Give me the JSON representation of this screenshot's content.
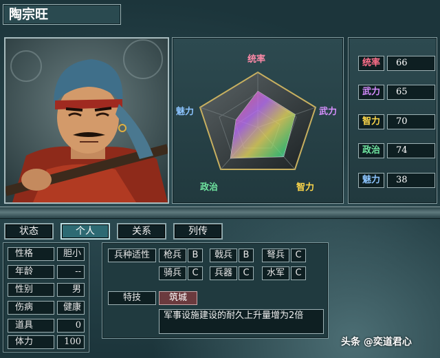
{
  "character": {
    "name": "陶宗旺"
  },
  "radar": {
    "labels": {
      "leadership": "统率",
      "war": "武力",
      "intelligence": "智力",
      "politics": "政治",
      "charm": "魅力"
    },
    "values": {
      "leadership": 66,
      "war": 65,
      "intelligence": 70,
      "politics": 74,
      "charm": 38
    }
  },
  "stats": [
    {
      "label": "统率",
      "value": "66",
      "color": "#ff6f8a"
    },
    {
      "label": "武力",
      "value": "65",
      "color": "#d68cff"
    },
    {
      "label": "智力",
      "value": "70",
      "color": "#ffd84a"
    },
    {
      "label": "政治",
      "value": "74",
      "color": "#6fe6a0"
    },
    {
      "label": "魅力",
      "value": "38",
      "color": "#8cc4ff"
    }
  ],
  "tabs": [
    {
      "label": "状态",
      "active": false
    },
    {
      "label": "个人",
      "active": true
    },
    {
      "label": "关系",
      "active": false
    },
    {
      "label": "列传",
      "active": false
    }
  ],
  "personal": [
    {
      "label": "性格",
      "value": "胆小"
    },
    {
      "label": "年龄",
      "value": "--"
    },
    {
      "label": "性别",
      "value": "男"
    },
    {
      "label": "伤病",
      "value": "健康"
    },
    {
      "label": "道具",
      "value": "0"
    },
    {
      "label": "体力",
      "value": "100"
    }
  ],
  "troops": {
    "header": "兵种适性",
    "items": [
      {
        "name": "枪兵",
        "grade": "B"
      },
      {
        "name": "戟兵",
        "grade": "B"
      },
      {
        "name": "弩兵",
        "grade": "C"
      },
      {
        "name": "骑兵",
        "grade": "C"
      },
      {
        "name": "兵器",
        "grade": "C"
      },
      {
        "name": "水军",
        "grade": "C"
      }
    ]
  },
  "skill": {
    "header": "特技",
    "name": "筑城",
    "description": "军事设施建设的耐久上升量增为2倍"
  },
  "watermark": "头条 @奕道君心"
}
